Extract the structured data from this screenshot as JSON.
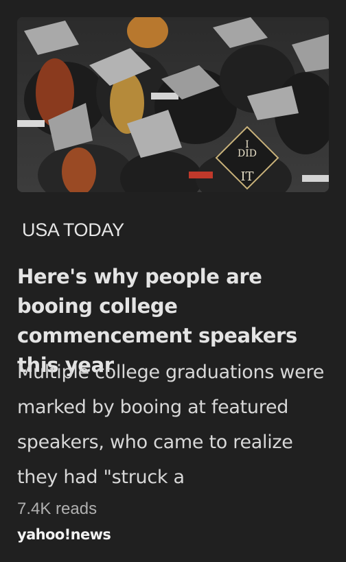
{
  "article": {
    "image_alt": "Graduates in caps, one cap reads I DID IT",
    "cap_text_line1": "I",
    "cap_text_line2": "DID",
    "cap_text_line3": "IT",
    "source": "USA TODAY",
    "headline": "Here's why people are booing college commencement speakers this year",
    "summary": "Multiple college graduations were marked by booing at featured speakers, who came to realize they had \"struck a",
    "reads": "7.4K reads",
    "brand": "yahoo!news"
  },
  "colors": {
    "background": "#202020",
    "text_primary": "#e4e4e4",
    "text_secondary": "#b0b0b0"
  }
}
